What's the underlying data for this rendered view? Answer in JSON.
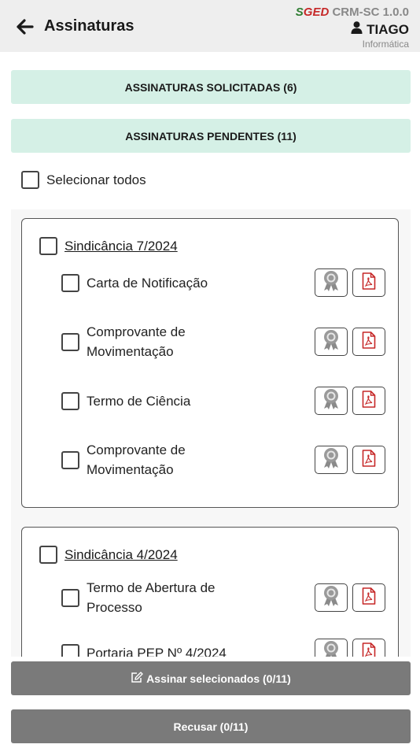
{
  "header": {
    "title": "Assinaturas",
    "brand_s": "S",
    "brand_ged": "GED",
    "app_version": "CRM-SC 1.0.0",
    "user": "TIAGO",
    "department": "Informática"
  },
  "sections": {
    "solicitadas": "ASSINATURAS SOLICITADAS (6)",
    "pendentes": "ASSINATURAS PENDENTES (11)"
  },
  "select_all": "Selecionar todos",
  "cases": [
    {
      "title": "Sindicância 7/2024",
      "documents": [
        {
          "line1": "Carta de Notificação",
          "line2": ""
        },
        {
          "line1": "Comprovante de",
          "line2": "Movimentação"
        },
        {
          "line1": "Termo de Ciência",
          "line2": ""
        },
        {
          "line1": "Comprovante de",
          "line2": "Movimentação"
        }
      ]
    },
    {
      "title": "Sindicância 4/2024",
      "documents": [
        {
          "line1": "Termo de Abertura de",
          "line2": "Processo"
        },
        {
          "line1": "Portaria PEP Nº 4/2024",
          "line2": ""
        }
      ]
    }
  ],
  "buttons": {
    "sign": "Assinar selecionados (0/11)",
    "refuse": "Recusar (0/11)"
  },
  "icons": {
    "certificate": "certificate-icon",
    "pdf": "pdf-icon",
    "pdf_color": "#c62828"
  }
}
